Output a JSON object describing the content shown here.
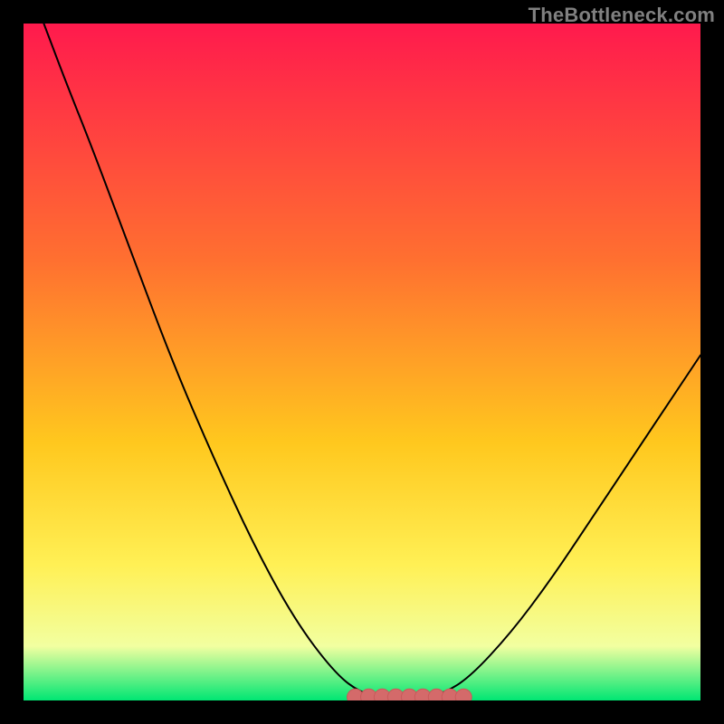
{
  "attribution": "TheBottleneck.com",
  "colors": {
    "frame": "#000000",
    "grad_top": "#ff1a4d",
    "grad_mid1": "#ff7030",
    "grad_mid2": "#ffc81e",
    "grad_mid3": "#fff055",
    "grad_mid4": "#f2ffa0",
    "grad_bottom": "#00e673",
    "curve": "#000000",
    "marker_fill": "#d46a6a",
    "marker_stroke": "#c85a5a"
  },
  "chart_data": {
    "type": "line",
    "title": "",
    "xlabel": "",
    "ylabel": "",
    "xlim": [
      0,
      100
    ],
    "ylim": [
      0,
      100
    ],
    "curve": [
      {
        "x": 3,
        "y": 100
      },
      {
        "x": 6,
        "y": 92
      },
      {
        "x": 10,
        "y": 82
      },
      {
        "x": 16,
        "y": 66
      },
      {
        "x": 22,
        "y": 50
      },
      {
        "x": 28,
        "y": 36
      },
      {
        "x": 34,
        "y": 23
      },
      {
        "x": 40,
        "y": 12
      },
      {
        "x": 46,
        "y": 4
      },
      {
        "x": 50,
        "y": 1
      },
      {
        "x": 54,
        "y": 0.2
      },
      {
        "x": 58,
        "y": 0.2
      },
      {
        "x": 62,
        "y": 1
      },
      {
        "x": 66,
        "y": 3.5
      },
      {
        "x": 72,
        "y": 10
      },
      {
        "x": 78,
        "y": 18
      },
      {
        "x": 84,
        "y": 27
      },
      {
        "x": 90,
        "y": 36
      },
      {
        "x": 96,
        "y": 45
      },
      {
        "x": 100,
        "y": 51
      }
    ],
    "minimum_markers_x": [
      49,
      51,
      53,
      55,
      57,
      59,
      61,
      63,
      65
    ],
    "minimum_markers_y": 0.5
  }
}
